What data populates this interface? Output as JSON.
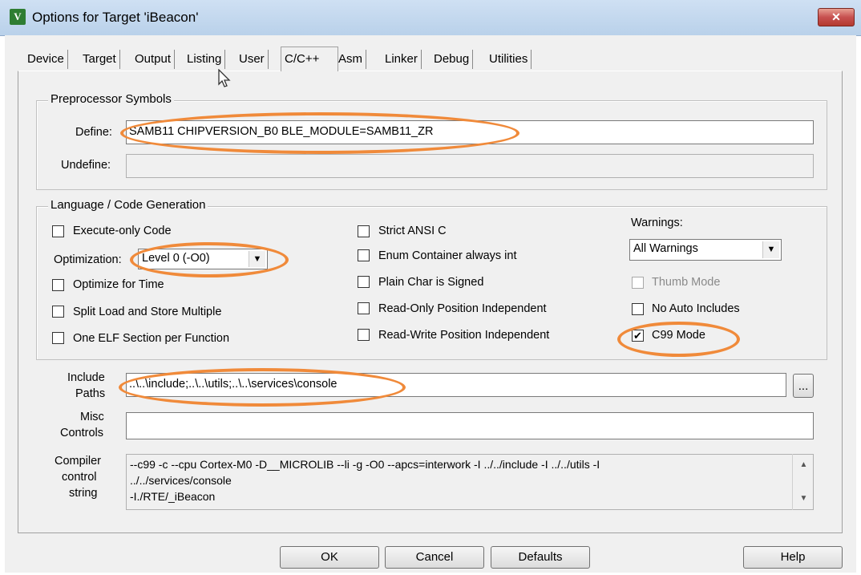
{
  "window": {
    "title": "Options for Target 'iBeacon'",
    "app_icon_glyph": "V",
    "close_glyph": "✕"
  },
  "tabs": [
    {
      "label": "Device"
    },
    {
      "label": "Target"
    },
    {
      "label": "Output"
    },
    {
      "label": "Listing"
    },
    {
      "label": "User"
    },
    {
      "label": "C/C++"
    },
    {
      "label": "Asm"
    },
    {
      "label": "Linker"
    },
    {
      "label": "Debug"
    },
    {
      "label": "Utilities"
    }
  ],
  "preprocessor": {
    "title": "Preprocessor Symbols",
    "define_label": "Define:",
    "define_value": "SAMB11 CHIPVERSION_B0 BLE_MODULE=SAMB11_ZR",
    "undefine_label": "Undefine:",
    "undefine_value": ""
  },
  "language": {
    "title": "Language / Code Generation",
    "execute_only": {
      "label": "Execute-only Code",
      "checked": false
    },
    "optimization_label": "Optimization:",
    "optimization_value": "Level 0 (-O0)",
    "optimize_time": {
      "label": "Optimize for Time",
      "checked": false
    },
    "split_load": {
      "label": "Split Load and Store Multiple",
      "checked": false
    },
    "one_elf": {
      "label": "One ELF Section per Function",
      "checked": false
    },
    "strict_ansi": {
      "label": "Strict ANSI C",
      "checked": false
    },
    "enum_container": {
      "label": "Enum Container always int",
      "checked": false
    },
    "plain_char": {
      "label": "Plain Char is Signed",
      "checked": false
    },
    "ropi": {
      "label": "Read-Only Position Independent",
      "checked": false
    },
    "rwpi": {
      "label": "Read-Write Position Independent",
      "checked": false
    },
    "warnings_label": "Warnings:",
    "warnings_value": "All Warnings",
    "thumb_mode": {
      "label": "Thumb Mode",
      "checked": false,
      "disabled": true
    },
    "no_auto_includes": {
      "label": "No Auto Includes",
      "checked": false
    },
    "c99_mode": {
      "label": "C99 Mode",
      "checked": true,
      "check_glyph": "✔"
    }
  },
  "include": {
    "label_line1": "Include",
    "label_line2": "Paths",
    "value": "..\\..\\include;..\\..\\utils;..\\..\\services\\console",
    "browse_label": "..."
  },
  "misc": {
    "label_line1": "Misc",
    "label_line2": "Controls",
    "value": ""
  },
  "compiler": {
    "label_line1": "Compiler",
    "label_line2": "control",
    "label_line3": "string",
    "line1": "--c99 -c --cpu Cortex-M0 -D__MICROLIB --li -g -O0 --apcs=interwork -I ../../include -I ../../utils -I",
    "line2": "../../services/console",
    "line3": "-I./RTE/_iBeacon",
    "scroll_up_glyph": "▲",
    "scroll_down_glyph": "▼"
  },
  "buttons": {
    "ok": "OK",
    "cancel": "Cancel",
    "defaults": "Defaults",
    "help": "Help"
  },
  "colors": {
    "highlight_ellipse": "#f08a3a",
    "close_button": "#c75050"
  }
}
